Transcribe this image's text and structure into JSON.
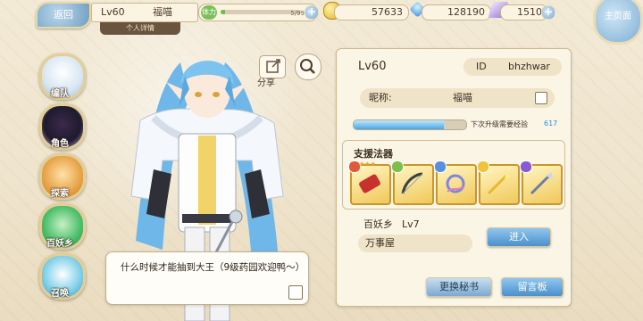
{
  "topbar": {
    "back_label": "返回",
    "level": "Lv60",
    "name": "福喵",
    "detail_tab": "个人详情",
    "stamina_label": "体力",
    "stamina_value": "5/99",
    "stamina_fraction": 0.05,
    "gold": "57633",
    "gems": "128190",
    "crystals": "1510",
    "main_page_label": "主页面"
  },
  "sidemenu": {
    "items": [
      {
        "label": "编队",
        "icon": "team-icon"
      },
      {
        "label": "角色",
        "icon": "character-icon"
      },
      {
        "label": "探索",
        "icon": "explore-icon"
      },
      {
        "label": "百妖乡",
        "icon": "village-icon"
      },
      {
        "label": "召唤",
        "icon": "summon-icon"
      }
    ]
  },
  "character": {
    "share_label": "分享",
    "speech": "什么时候才能抽到大王（9级药园欢迎鸭～）"
  },
  "panel": {
    "level": "Lv60",
    "id_label": "ID",
    "id_value": "bhzhwar",
    "nickname_label": "昵称:",
    "nickname_value": "福喵",
    "exp_label": "下次升级需要经验",
    "exp_value": "617",
    "exp_fraction": 0.8,
    "support_title": "支援法器",
    "realm_label": "百妖乡",
    "realm_level": "Lv7",
    "place": "万事屋",
    "enter_label": "进入",
    "secretary_label": "更换秘书",
    "message_label": "留言板"
  },
  "colors": {
    "accent_blue": "#4b8fcc",
    "panel_bg": "#fbf5e6",
    "gold_frame": "#c8962a"
  }
}
